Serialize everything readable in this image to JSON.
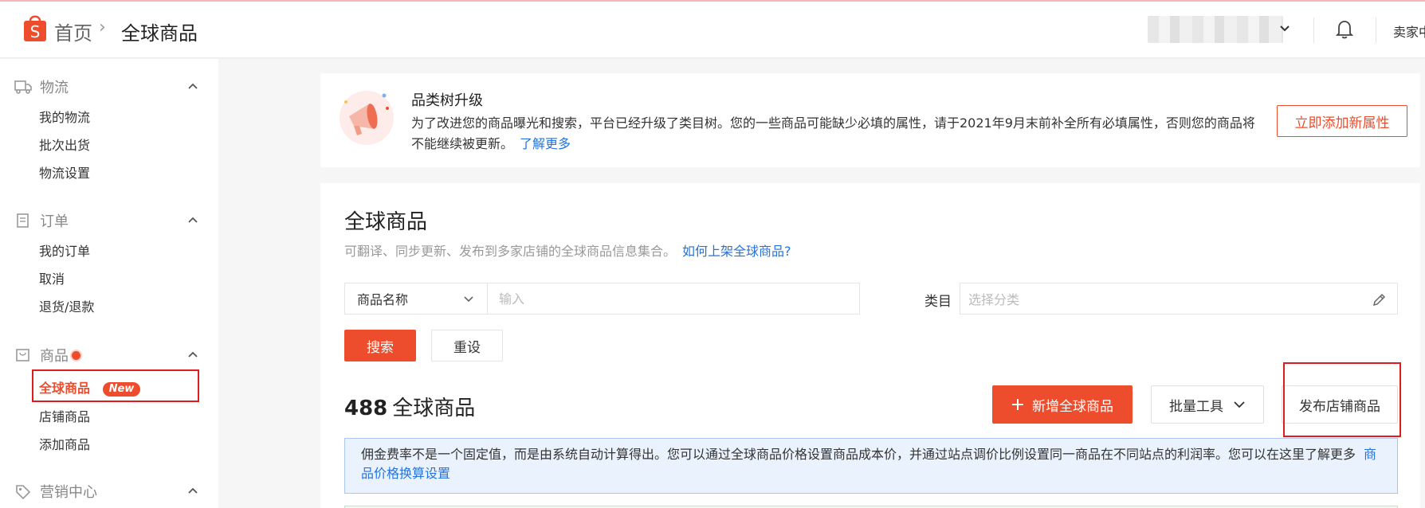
{
  "header": {
    "breadcrumb_home": "首页",
    "breadcrumb_separator": "›",
    "breadcrumb_current": "全球商品",
    "seller_label": "卖家中心",
    "logo_letter": "S",
    "brand_color": "#ee4d2d"
  },
  "sidebar": {
    "sections": [
      {
        "title": "物流",
        "icon": "truck-icon",
        "items": [
          "我的物流",
          "批次出货",
          "物流设置"
        ]
      },
      {
        "title": "订单",
        "icon": "clipboard-icon",
        "items": [
          "我的订单",
          "取消",
          "退货/退款"
        ]
      },
      {
        "title": "商品",
        "icon": "bag-icon",
        "items": [
          "全球商品",
          "店铺商品",
          "添加商品"
        ]
      },
      {
        "title": "营销中心",
        "icon": "tag-icon",
        "items": []
      }
    ],
    "active_item": "全球商品",
    "new_badge": "New"
  },
  "banner": {
    "title": "品类树升级",
    "text": "为了改进您的商品曝光和搜索，平台已经升级了类目树。您的一些商品可能缺少必填的属性，请于2021年9月末前补全所有必填属性，否则您的商品将不能继续被更新。",
    "link": "了解更多",
    "button": "立即添加新属性"
  },
  "main": {
    "title": "全球商品",
    "subtitle": "可翻译、同步更新、发布到多家店铺的全球商品信息集合。",
    "subtitle_link": "如何上架全球商品?",
    "filter_select": "商品名称",
    "filter_placeholder": "输入",
    "category_label": "类目",
    "category_placeholder": "选择分类",
    "search_button": "搜索",
    "reset_button": "重设",
    "count": "488",
    "count_label": "全球商品",
    "add_button": "新增全球商品",
    "bulk_button": "批量工具",
    "publish_button": "发布店铺商品",
    "info_text": "佣金费率不是一个固定值，而是由系统自动计算得出。您可以通过全球商品价格设置商品成本价，并通过站点调价比例设置同一商品在不同站点的利润率。您可以在这里了解更多",
    "info_link": "商品价格换算设置"
  }
}
